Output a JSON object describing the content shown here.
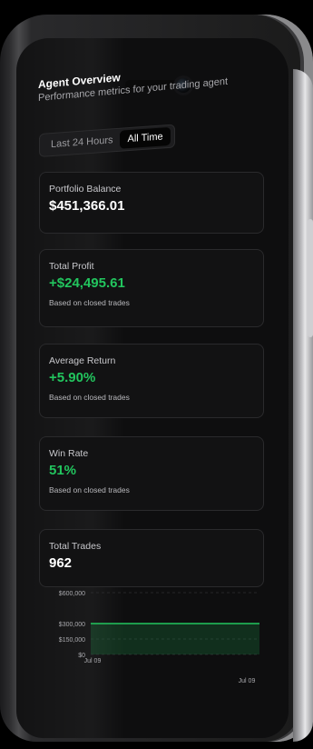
{
  "header": {
    "title": "Agent Overview",
    "subtitle": "Performance metrics for your trading agent"
  },
  "range_toggle": {
    "options": [
      "Last 24 Hours",
      "All Time"
    ],
    "selected": "All Time"
  },
  "cards": [
    {
      "label": "Portfolio Balance",
      "value": "$451,366.01",
      "note": ""
    },
    {
      "label": "Total Profit",
      "value": "+$24,495.61",
      "note": "Based on closed trades"
    },
    {
      "label": "Average Return",
      "value": "+5.90%",
      "note": "Based on closed trades"
    },
    {
      "label": "Win Rate",
      "value": "51%",
      "note": "Based on closed trades"
    },
    {
      "label": "Total Trades",
      "value": "962",
      "note": ""
    }
  ],
  "colors": {
    "positive": "#22c55e",
    "background": "#0e0e0f"
  },
  "chart_data": {
    "type": "area",
    "x": [
      "Jul 09",
      "Jul 09"
    ],
    "series": [
      {
        "values": [
          300000,
          300000
        ]
      }
    ],
    "yticks": [
      "$600,000",
      "$300,000",
      "$150,000",
      "$0"
    ],
    "ylim": [
      0,
      600000
    ],
    "grid": true
  }
}
